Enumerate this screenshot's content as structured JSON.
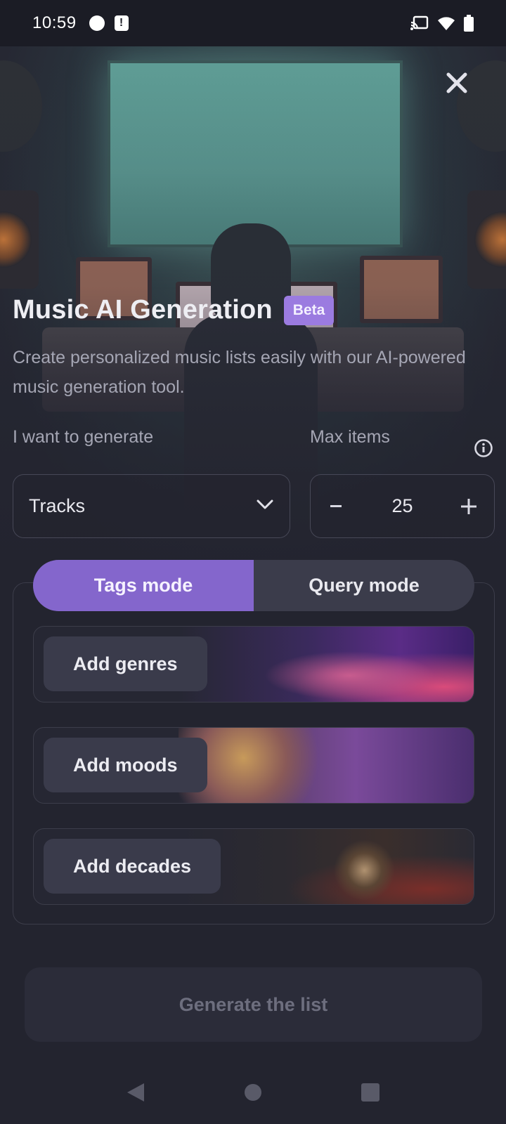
{
  "status_bar": {
    "time": "10:59",
    "icons": [
      "notification-dot-icon",
      "alert-icon",
      "cast-icon",
      "wifi-icon",
      "battery-icon"
    ]
  },
  "header": {
    "title": "Music AI Generation",
    "badge": "Beta",
    "subtitle": "Create personalized music lists easily with our AI-powered music generation tool."
  },
  "form": {
    "generate_label": "I want to generate",
    "generate_value": "Tracks",
    "max_items_label": "Max items",
    "max_items_value": "25",
    "decrement_label": "−",
    "increment_label": "+"
  },
  "modes": {
    "tabs": [
      {
        "label": "Tags mode",
        "active": true
      },
      {
        "label": "Query mode",
        "active": false
      }
    ]
  },
  "tags": {
    "cards": [
      {
        "label": "Add genres"
      },
      {
        "label": "Add moods"
      },
      {
        "label": "Add decades"
      }
    ]
  },
  "actions": {
    "generate_label": "Generate the list"
  },
  "colors": {
    "accent": "#8466cc",
    "badge": "#9b7be0",
    "background": "#23242f"
  }
}
